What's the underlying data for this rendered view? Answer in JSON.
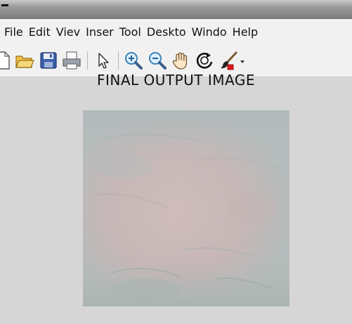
{
  "menu": {
    "items": [
      "File",
      "Edit",
      "Viev",
      "Inser",
      "Tool",
      "Deskto",
      "Windo",
      "Help"
    ]
  },
  "toolbar": {
    "icons": [
      "new-file-icon",
      "open-folder-icon",
      "save-icon",
      "print-icon",
      "select-arrow-icon",
      "zoom-in-icon",
      "zoom-out-icon",
      "pan-hand-icon",
      "rotate-3d-icon",
      "brush-icon"
    ]
  },
  "figure": {
    "title": "FINAL OUTPUT IMAGE"
  },
  "colors": {
    "window_bg": "#d6d6d6",
    "menubar_bg": "#f1f1f1",
    "image_pink": "#cfb8b6",
    "image_teal": "#a7b6b3"
  }
}
